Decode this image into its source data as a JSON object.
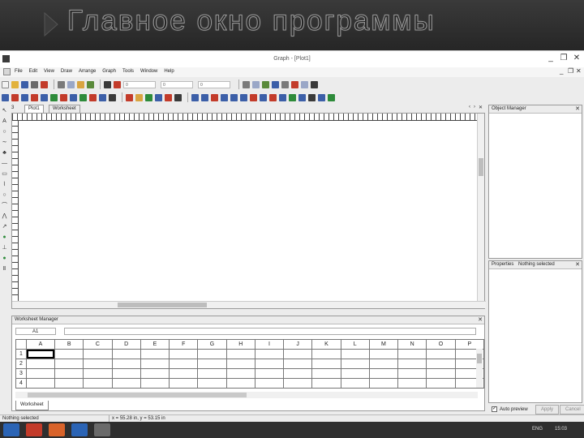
{
  "slide": {
    "title": "Главное окно программы"
  },
  "window": {
    "title": "Graph - [Plot1]",
    "minimize": "_",
    "restore": "❐",
    "close": "✕"
  },
  "menu": {
    "items": [
      "File",
      "Edit",
      "View",
      "Draw",
      "Arrange",
      "Graph",
      "Tools",
      "Window",
      "Help"
    ],
    "mdi_min": "_",
    "mdi_restore": "❐",
    "mdi_close": "✕"
  },
  "toolbar1": {
    "field_a": "0",
    "field_b": "0",
    "field_c": "0"
  },
  "tabs": {
    "prefix": "3",
    "items": [
      "Plot1",
      "Worksheet"
    ],
    "close": "✕"
  },
  "object_manager": {
    "title": "Object Manager",
    "close": "✕"
  },
  "property_manager": {
    "title": "Properties",
    "value": "Nothing selected",
    "close": "✕"
  },
  "worksheet_manager": {
    "title": "Worksheet Manager",
    "close": "✕",
    "cell_ref": "A1",
    "columns": [
      "A",
      "B",
      "C",
      "D",
      "E",
      "F",
      "G",
      "H",
      "I",
      "J",
      "K",
      "L",
      "M",
      "N",
      "O",
      "P"
    ],
    "rows": [
      "1",
      "2",
      "3",
      "4"
    ],
    "tab_label": "Worksheet"
  },
  "auto_preview": {
    "label": "Auto preview",
    "checked": "✓",
    "apply": "Apply",
    "cancel": "Cancel"
  },
  "statusbar": {
    "left": "Nothing selected",
    "coords": "x = 55.28 in, y = 53.15 in"
  },
  "taskbar": {
    "lang": "ENG",
    "time": "15:03"
  },
  "colors": {
    "accent_red": "#c33b2a",
    "accent_blue": "#2b64b5",
    "accent_green": "#2e8b3a"
  },
  "icons": [
    "app-icon",
    "new-icon",
    "open-icon",
    "save-icon",
    "print-icon",
    "cut-icon",
    "copy-icon",
    "paste-icon",
    "undo-icon",
    "redo-icon",
    "zoom-icon",
    "pointer-icon",
    "text-icon",
    "line-icon",
    "rectangle-icon",
    "ellipse-icon",
    "polygon-icon",
    "polyline-icon",
    "spline-icon",
    "plot-icon",
    "axis-icon",
    "legend-icon"
  ]
}
